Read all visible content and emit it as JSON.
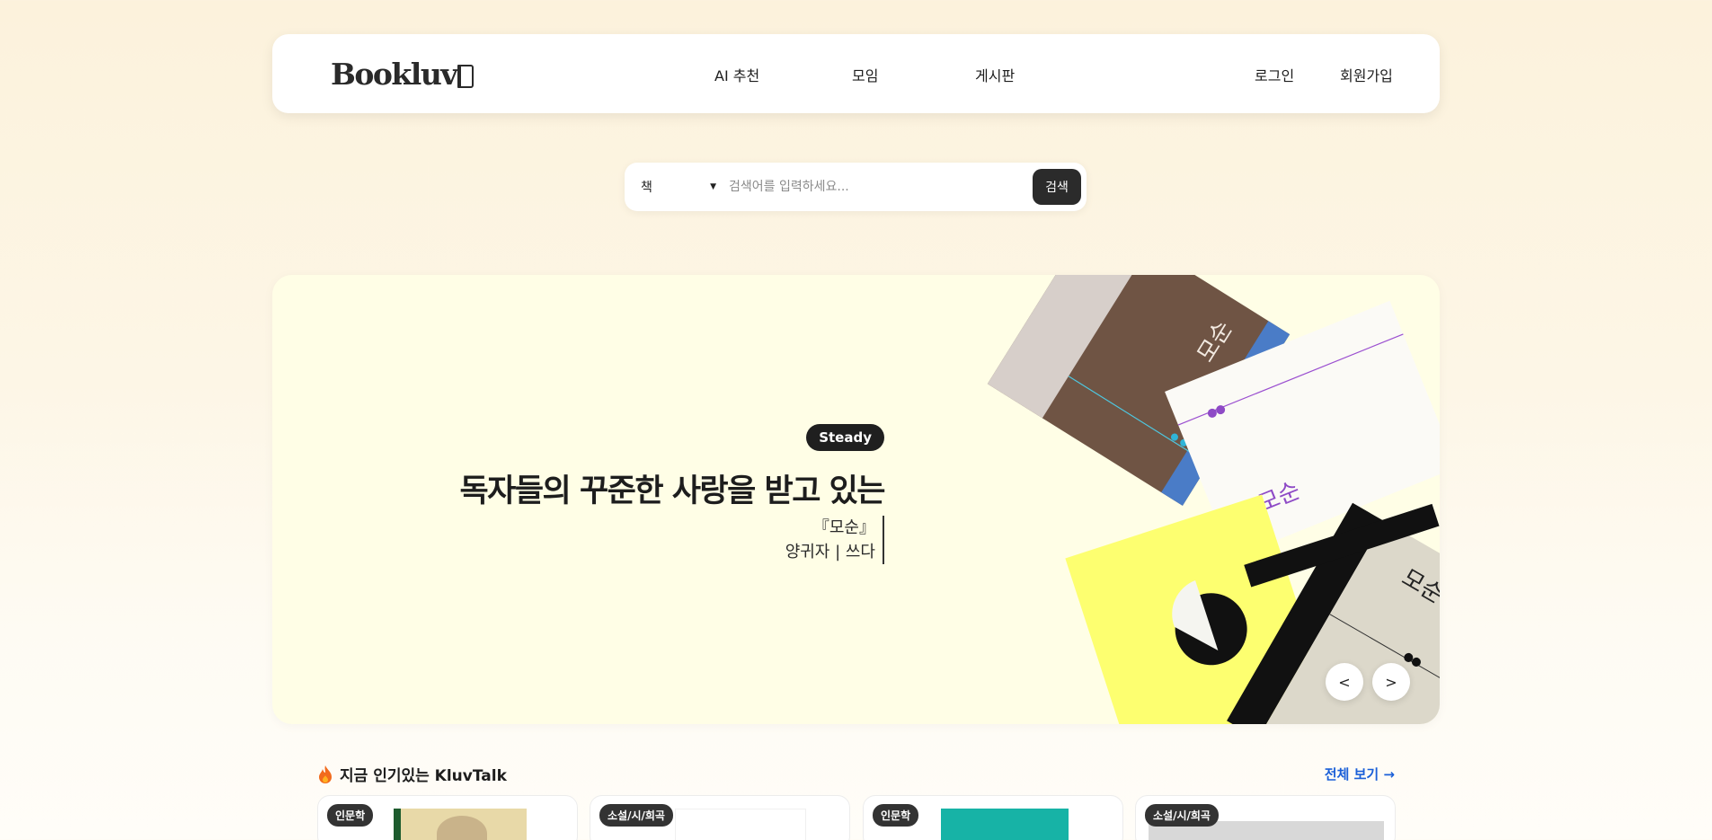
{
  "header": {
    "logo_text": "Bookluv",
    "nav": [
      "AI 추천",
      "모임",
      "게시판"
    ],
    "login": "로그인",
    "signup": "회원가입"
  },
  "search": {
    "category": "책",
    "placeholder": "검색어를 입력하세요...",
    "button": "검색"
  },
  "banner": {
    "badge": "Steady",
    "title": "독자들의 꾸준한 사랑을 받고 있는",
    "book_title": "『모순』",
    "book_author": "양귀자 | 쓰다",
    "prev_label": "<",
    "next_label": ">",
    "cover_text": "모순",
    "colors": {
      "background": "#fffee6",
      "brown": "#6f5444",
      "blue": "#4a7cc7",
      "yellow": "#fdff70",
      "beige": "#dcd8ca"
    }
  },
  "popular": {
    "title": "지금 인기있는 KluvTalk",
    "see_all": "전체 보기 →",
    "cards": [
      {
        "tag": "인문학"
      },
      {
        "tag": "소설/시/희곡"
      },
      {
        "tag": "인문학"
      },
      {
        "tag": "소설/시/희곡"
      }
    ]
  }
}
